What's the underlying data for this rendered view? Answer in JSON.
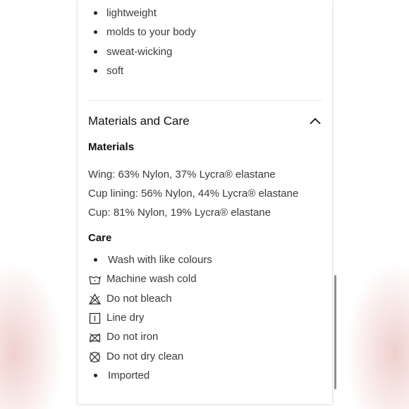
{
  "features": {
    "items": [
      "lightweight",
      "molds to your body",
      "sweat-wicking",
      "soft"
    ]
  },
  "materials_and_care": {
    "title": "Materials and Care",
    "expanded": true,
    "materials_heading": "Materials",
    "materials": [
      "Wing: 63% Nylon, 37% Lycra® elastane",
      "Cup lining: 56% Nylon, 44% Lycra® elastane",
      "Cup: 81% Nylon, 19% Lycra® elastane"
    ],
    "care_heading": "Care",
    "care": [
      {
        "text": "Wash with like colours",
        "icon": "bullet"
      },
      {
        "text": "Machine wash cold",
        "icon": "machine-wash-cold-icon"
      },
      {
        "text": "Do not bleach",
        "icon": "do-not-bleach-icon"
      },
      {
        "text": "Line dry",
        "icon": "line-dry-icon"
      },
      {
        "text": "Do not iron",
        "icon": "do-not-iron-icon"
      },
      {
        "text": "Do not dry clean",
        "icon": "do-not-dry-clean-icon"
      },
      {
        "text": "Imported",
        "icon": "bullet"
      }
    ]
  }
}
